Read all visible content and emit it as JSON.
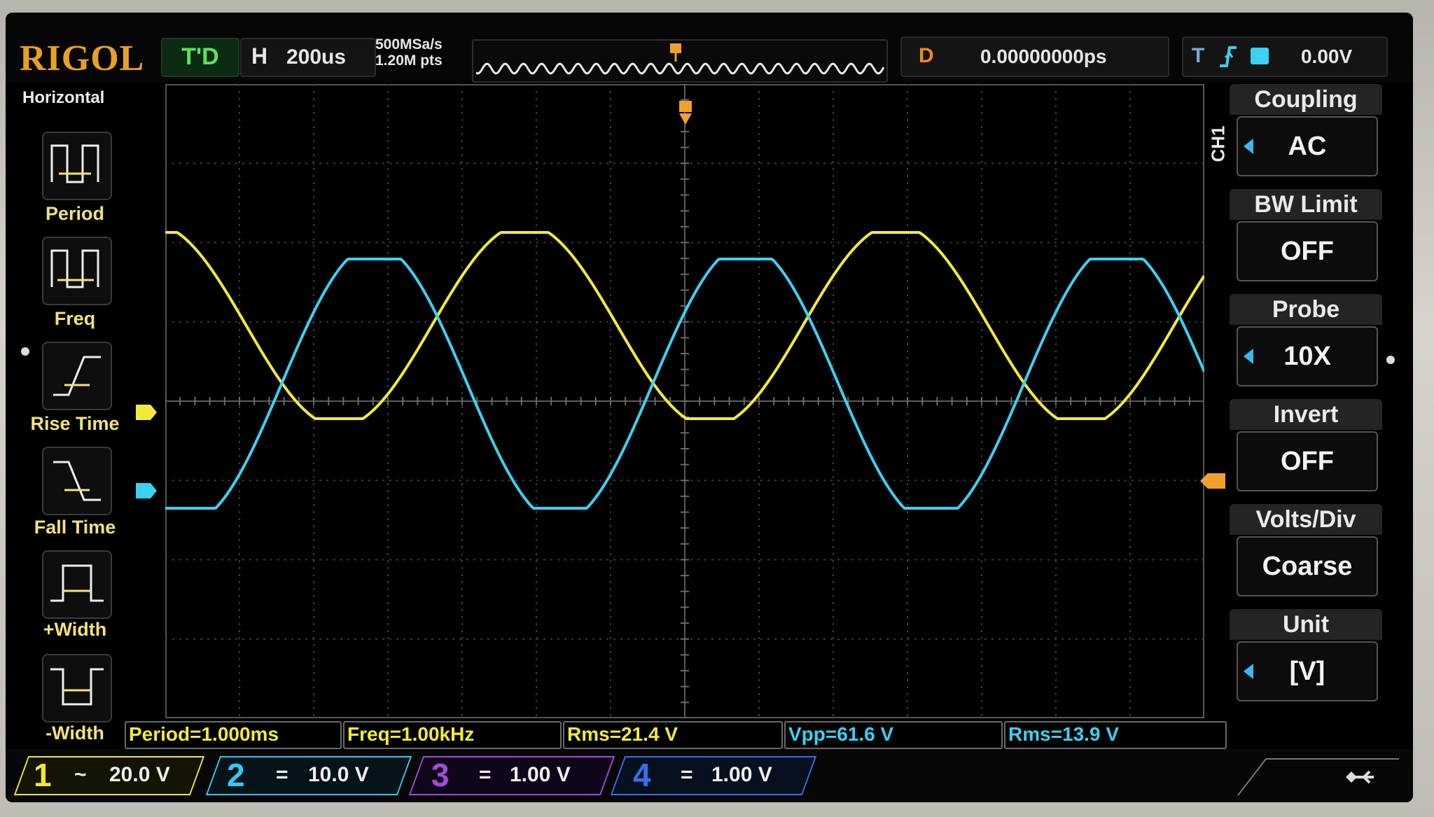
{
  "brand": "RIGOL",
  "top": {
    "mode": "T'D",
    "h_label": "H",
    "timebase": "200us",
    "sample_rate": "500MSa/s",
    "memory_depth": "1.20M pts",
    "delay_label": "D",
    "delay_value": "0.00000000ps",
    "trigger_label": "T",
    "trigger_level": "0.00V"
  },
  "left_menu": {
    "title": "Horizontal",
    "items": [
      "Period",
      "Freq",
      "Rise Time",
      "Fall Time",
      "+Width",
      "-Width"
    ]
  },
  "right_menu": {
    "channel": "CH1",
    "items": [
      {
        "title": "Coupling",
        "value": "AC"
      },
      {
        "title": "BW Limit",
        "value": "OFF"
      },
      {
        "title": "Probe",
        "value": "10X"
      },
      {
        "title": "Invert",
        "value": "OFF"
      },
      {
        "title": "Volts/Div",
        "value": "Coarse"
      },
      {
        "title": "Unit",
        "value": "[V]"
      }
    ]
  },
  "measurements": [
    "Period=1.000ms",
    "Freq=1.00kHz",
    "Rms=21.4 V",
    "Vpp=61.6 V",
    "Rms=13.9 V"
  ],
  "channels": [
    {
      "num": "1",
      "coupling_symbol": "~",
      "scale": "20.0 V",
      "color": "#f0e635"
    },
    {
      "num": "2",
      "coupling_symbol": "=",
      "scale": "10.0 V",
      "color": "#38c6ee"
    },
    {
      "num": "3",
      "coupling_symbol": "=",
      "scale": "1.00 V",
      "color": "#a04cd8"
    },
    {
      "num": "4",
      "coupling_symbol": "=",
      "scale": "1.00 V",
      "color": "#3a6ee8"
    }
  ],
  "colors": {
    "ch1_trace": "#f2ea3a",
    "ch2_trace": "#3cd0f2",
    "grid": "#3a3a3a",
    "trigger_marker": "#f2a02c",
    "logo": "#e7a026"
  },
  "icons": [
    "period-icon",
    "freq-icon",
    "rise-time-icon",
    "fall-time-icon",
    "pos-width-icon",
    "neg-width-icon",
    "trigger-edge-icon",
    "usb-icon"
  ]
}
